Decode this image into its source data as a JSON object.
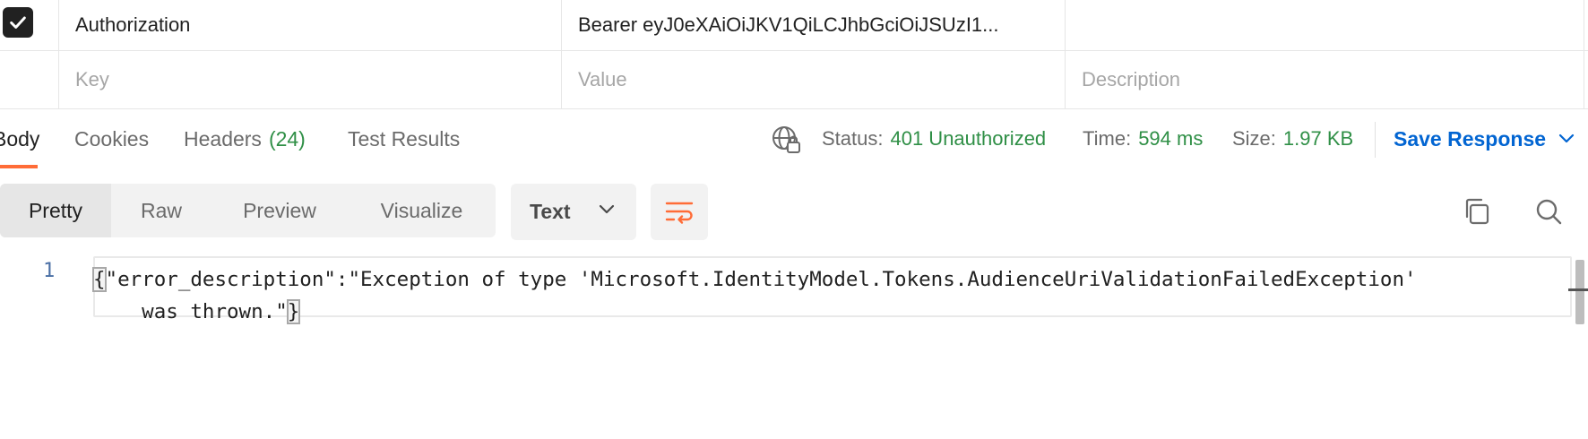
{
  "headers_table": {
    "rows": [
      {
        "checked": true,
        "key": "Authorization",
        "value": "Bearer eyJ0eXAiOiJKV1QiLCJhbGciOiJSUzI1...",
        "description": ""
      }
    ],
    "new_row": {
      "key_placeholder": "Key",
      "value_placeholder": "Value",
      "description_placeholder": "Description"
    }
  },
  "response": {
    "tabs": [
      {
        "label": "Body",
        "active": true
      },
      {
        "label": "Cookies",
        "active": false
      },
      {
        "label": "Headers",
        "count": "(24)",
        "active": false
      },
      {
        "label": "Test Results",
        "active": false
      }
    ],
    "status": {
      "label": "Status:",
      "value": "401 Unauthorized"
    },
    "time": {
      "label": "Time:",
      "value": "594 ms"
    },
    "size": {
      "label": "Size:",
      "value": "1.97 KB"
    },
    "save_label": "Save Response",
    "view_modes": [
      "Pretty",
      "Raw",
      "Preview",
      "Visualize"
    ],
    "active_view": "Pretty",
    "format": "Text",
    "body": {
      "line_number": "1",
      "open_brace": "{",
      "line1": "\"error_description\":\"Exception of type 'Microsoft.IdentityModel.Tokens.AudienceUriValidationFailedException'",
      "line2": "    was thrown.\"",
      "close_brace": "}"
    }
  },
  "colors": {
    "accent_orange": "#ff6c37",
    "status_green": "#2f8f46",
    "link_blue": "#0265d2"
  },
  "icons": [
    "checkbox-checked-icon",
    "globe-lock-icon",
    "chevron-down-icon",
    "wrap-lines-icon",
    "copy-icon",
    "search-icon"
  ]
}
